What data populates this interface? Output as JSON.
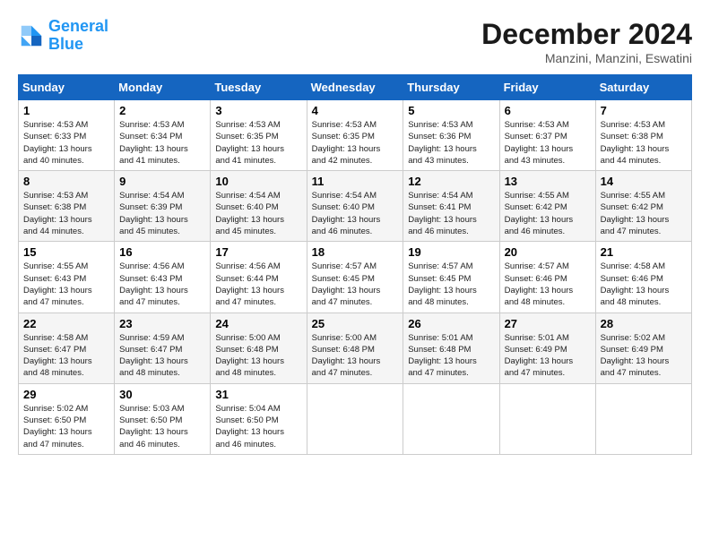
{
  "logo": {
    "line1": "General",
    "line2": "Blue"
  },
  "title": "December 2024",
  "location": "Manzini, Manzini, Eswatini",
  "days_of_week": [
    "Sunday",
    "Monday",
    "Tuesday",
    "Wednesday",
    "Thursday",
    "Friday",
    "Saturday"
  ],
  "weeks": [
    [
      {
        "day": "1",
        "info": "Sunrise: 4:53 AM\nSunset: 6:33 PM\nDaylight: 13 hours\nand 40 minutes."
      },
      {
        "day": "2",
        "info": "Sunrise: 4:53 AM\nSunset: 6:34 PM\nDaylight: 13 hours\nand 41 minutes."
      },
      {
        "day": "3",
        "info": "Sunrise: 4:53 AM\nSunset: 6:35 PM\nDaylight: 13 hours\nand 41 minutes."
      },
      {
        "day": "4",
        "info": "Sunrise: 4:53 AM\nSunset: 6:35 PM\nDaylight: 13 hours\nand 42 minutes."
      },
      {
        "day": "5",
        "info": "Sunrise: 4:53 AM\nSunset: 6:36 PM\nDaylight: 13 hours\nand 43 minutes."
      },
      {
        "day": "6",
        "info": "Sunrise: 4:53 AM\nSunset: 6:37 PM\nDaylight: 13 hours\nand 43 minutes."
      },
      {
        "day": "7",
        "info": "Sunrise: 4:53 AM\nSunset: 6:38 PM\nDaylight: 13 hours\nand 44 minutes."
      }
    ],
    [
      {
        "day": "8",
        "info": "Sunrise: 4:53 AM\nSunset: 6:38 PM\nDaylight: 13 hours\nand 44 minutes."
      },
      {
        "day": "9",
        "info": "Sunrise: 4:54 AM\nSunset: 6:39 PM\nDaylight: 13 hours\nand 45 minutes."
      },
      {
        "day": "10",
        "info": "Sunrise: 4:54 AM\nSunset: 6:40 PM\nDaylight: 13 hours\nand 45 minutes."
      },
      {
        "day": "11",
        "info": "Sunrise: 4:54 AM\nSunset: 6:40 PM\nDaylight: 13 hours\nand 46 minutes."
      },
      {
        "day": "12",
        "info": "Sunrise: 4:54 AM\nSunset: 6:41 PM\nDaylight: 13 hours\nand 46 minutes."
      },
      {
        "day": "13",
        "info": "Sunrise: 4:55 AM\nSunset: 6:42 PM\nDaylight: 13 hours\nand 46 minutes."
      },
      {
        "day": "14",
        "info": "Sunrise: 4:55 AM\nSunset: 6:42 PM\nDaylight: 13 hours\nand 47 minutes."
      }
    ],
    [
      {
        "day": "15",
        "info": "Sunrise: 4:55 AM\nSunset: 6:43 PM\nDaylight: 13 hours\nand 47 minutes."
      },
      {
        "day": "16",
        "info": "Sunrise: 4:56 AM\nSunset: 6:43 PM\nDaylight: 13 hours\nand 47 minutes."
      },
      {
        "day": "17",
        "info": "Sunrise: 4:56 AM\nSunset: 6:44 PM\nDaylight: 13 hours\nand 47 minutes."
      },
      {
        "day": "18",
        "info": "Sunrise: 4:57 AM\nSunset: 6:45 PM\nDaylight: 13 hours\nand 47 minutes."
      },
      {
        "day": "19",
        "info": "Sunrise: 4:57 AM\nSunset: 6:45 PM\nDaylight: 13 hours\nand 48 minutes."
      },
      {
        "day": "20",
        "info": "Sunrise: 4:57 AM\nSunset: 6:46 PM\nDaylight: 13 hours\nand 48 minutes."
      },
      {
        "day": "21",
        "info": "Sunrise: 4:58 AM\nSunset: 6:46 PM\nDaylight: 13 hours\nand 48 minutes."
      }
    ],
    [
      {
        "day": "22",
        "info": "Sunrise: 4:58 AM\nSunset: 6:47 PM\nDaylight: 13 hours\nand 48 minutes."
      },
      {
        "day": "23",
        "info": "Sunrise: 4:59 AM\nSunset: 6:47 PM\nDaylight: 13 hours\nand 48 minutes."
      },
      {
        "day": "24",
        "info": "Sunrise: 5:00 AM\nSunset: 6:48 PM\nDaylight: 13 hours\nand 48 minutes."
      },
      {
        "day": "25",
        "info": "Sunrise: 5:00 AM\nSunset: 6:48 PM\nDaylight: 13 hours\nand 47 minutes."
      },
      {
        "day": "26",
        "info": "Sunrise: 5:01 AM\nSunset: 6:48 PM\nDaylight: 13 hours\nand 47 minutes."
      },
      {
        "day": "27",
        "info": "Sunrise: 5:01 AM\nSunset: 6:49 PM\nDaylight: 13 hours\nand 47 minutes."
      },
      {
        "day": "28",
        "info": "Sunrise: 5:02 AM\nSunset: 6:49 PM\nDaylight: 13 hours\nand 47 minutes."
      }
    ],
    [
      {
        "day": "29",
        "info": "Sunrise: 5:02 AM\nSunset: 6:50 PM\nDaylight: 13 hours\nand 47 minutes."
      },
      {
        "day": "30",
        "info": "Sunrise: 5:03 AM\nSunset: 6:50 PM\nDaylight: 13 hours\nand 46 minutes."
      },
      {
        "day": "31",
        "info": "Sunrise: 5:04 AM\nSunset: 6:50 PM\nDaylight: 13 hours\nand 46 minutes."
      },
      null,
      null,
      null,
      null
    ]
  ]
}
